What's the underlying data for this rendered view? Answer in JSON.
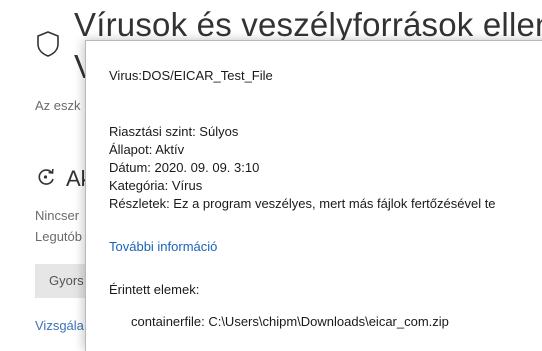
{
  "background": {
    "title": "Vírusok és veszélyforrások elleni",
    "title_cont": "V",
    "description": "Az eszk",
    "section_heading": "Ak",
    "line1": "Nincser",
    "line2": "Legutób",
    "button_label": "Gyors",
    "link": "Vizsgála"
  },
  "dialog": {
    "threat_name": "Virus:DOS/EICAR_Test_File",
    "details": [
      "Riasztási szint: Súlyos",
      "Állapot: Aktív",
      "Dátum: 2020. 09. 09. 3:10",
      "Kategória: Vírus",
      "Részletek: Ez a program veszélyes, mert más fájlok fertőzésével te"
    ],
    "more_info": "További információ",
    "affected_label": "Érintett elemek:",
    "affected_item": "containerfile: C:\\Users\\chipm\\Downloads\\eicar_com.zip"
  },
  "colors": {
    "link": "#1a63b8",
    "muted_text": "#6b6b6b",
    "button_bg": "#e6e6e6"
  },
  "icons": [
    "shield-icon",
    "refresh-icon"
  ]
}
